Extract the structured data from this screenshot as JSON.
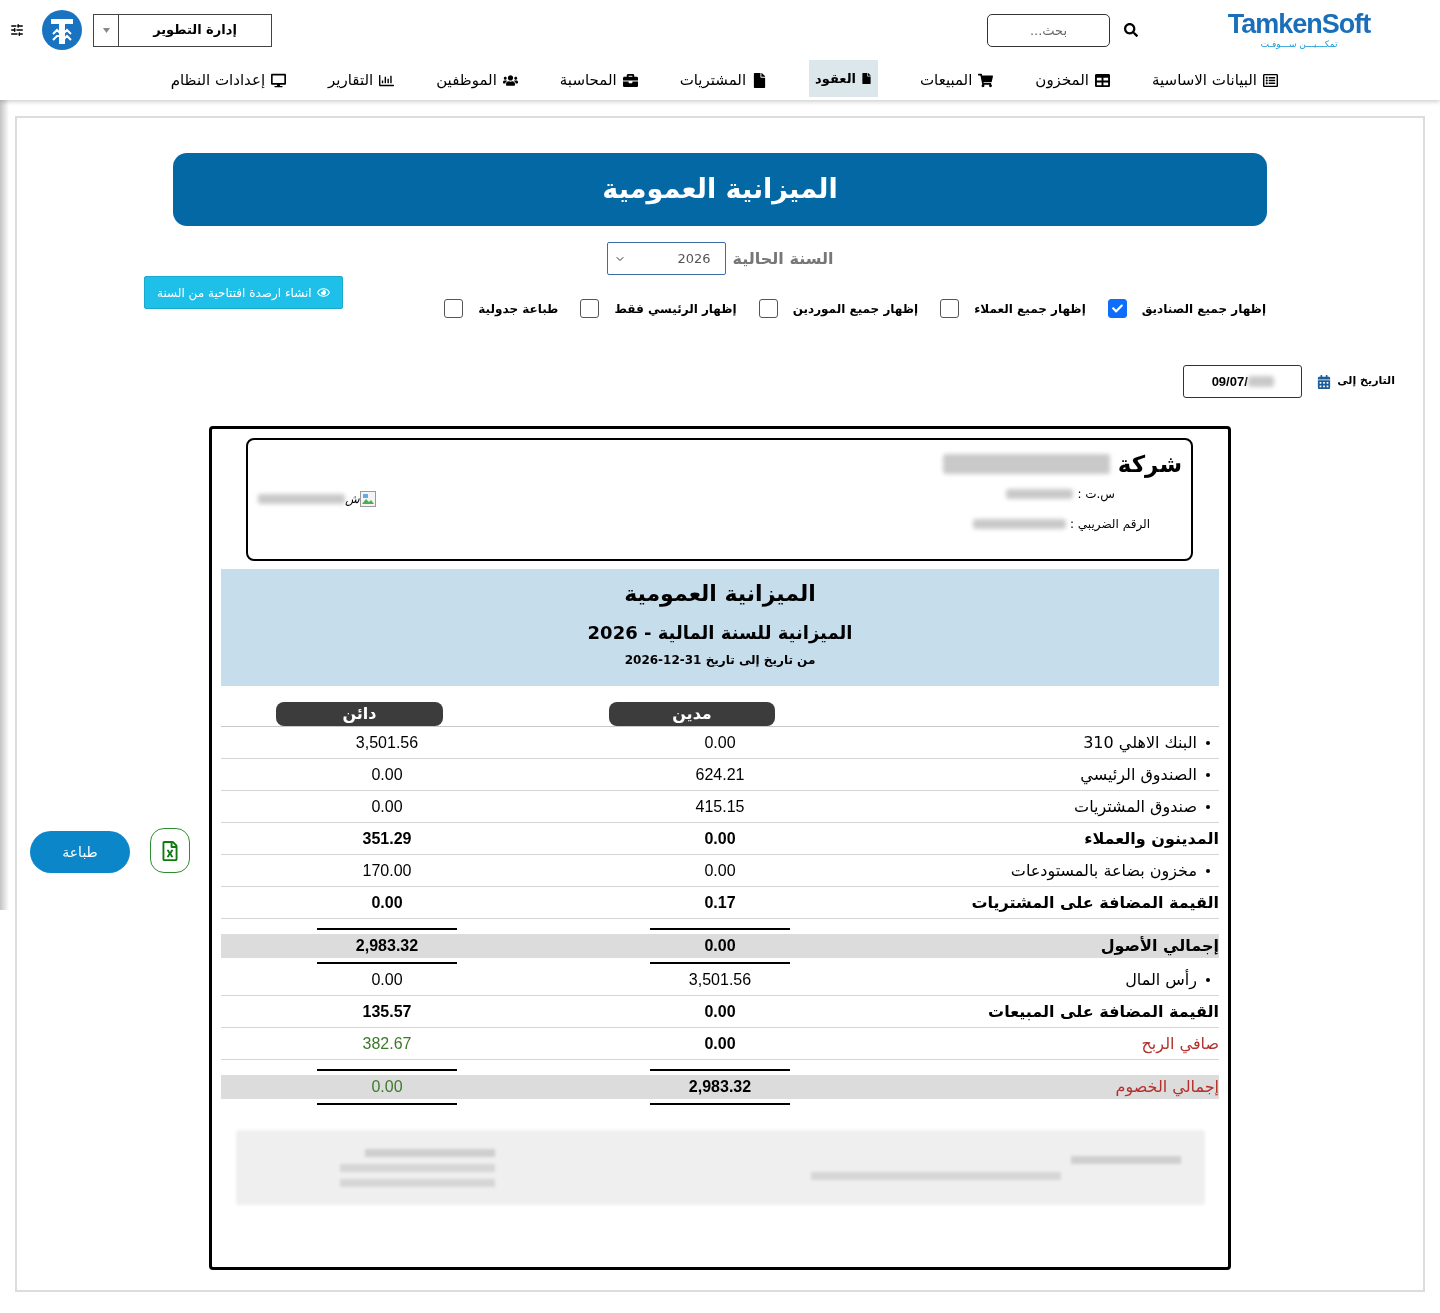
{
  "header": {
    "logo_text": "TamkenSoft",
    "logo_tagline": "تمكـــيـــن ســـوفـت",
    "search": {
      "placeholder": "بحث..."
    },
    "branch_select": {
      "value": "إدارة التطوير"
    }
  },
  "nav": [
    {
      "label": "البيانات الاساسية",
      "selected": false
    },
    {
      "label": "المخزون",
      "selected": false
    },
    {
      "label": "المبيعات",
      "selected": false
    },
    {
      "label": "العقود",
      "selected": true
    },
    {
      "label": "المشتريات",
      "selected": false
    },
    {
      "label": "المحاسبة",
      "selected": false
    },
    {
      "label": "الموظفين",
      "selected": false
    },
    {
      "label": "التقارير",
      "selected": false
    },
    {
      "label": "إعدادات النظام",
      "selected": false
    }
  ],
  "page_title": "الميزانية العمومية",
  "year_filter": {
    "label": "السنة الحالية",
    "value": "2026"
  },
  "opening_balance_button": "انشاء ارصدة افتتاحية من السنة",
  "options": [
    {
      "label": "إظهار جميع الصناديق",
      "checked": true
    },
    {
      "label": "إظهار جميع العملاء",
      "checked": false
    },
    {
      "label": "إظهار جميع الموردين",
      "checked": false
    },
    {
      "label": "إظهار الرئيسي فقط",
      "checked": false
    },
    {
      "label": "طباعة جدولية",
      "checked": false
    }
  ],
  "date_filter": {
    "label": "التاريخ إلى",
    "value": "09/07/"
  },
  "report": {
    "company": {
      "prefix": "شركة",
      "cr_label": "س.ت :",
      "tax_label": "الرقم الضريبي :",
      "logo_alt": "ش"
    },
    "title": "الميزانية العمومية",
    "subtitle": "الميزانية للسنة المالية - 2026",
    "period": "من تاريخ إلى تاريخ 31-12-2026",
    "columns": [
      "مدين",
      "دائن"
    ],
    "rows": [
      {
        "kind": "account",
        "label": "البنك الاهلي 310",
        "debit": "0.00",
        "credit": "3,501.56",
        "accent": false
      },
      {
        "kind": "account",
        "label": "الصندوق الرئيسي",
        "debit": "624.21",
        "credit": "0.00",
        "accent": false
      },
      {
        "kind": "account",
        "label": "صندوق المشتريات",
        "debit": "415.15",
        "credit": "0.00",
        "accent": false
      },
      {
        "kind": "group",
        "label": "المدينون والعملاء",
        "debit": "0.00",
        "credit": "351.29",
        "accent": false
      },
      {
        "kind": "account",
        "label": "مخزون بضاعة بالمستودعات",
        "debit": "0.00",
        "credit": "170.00",
        "accent": false
      },
      {
        "kind": "group",
        "label": "القيمة المضافة على المشتريات",
        "debit": "0.17",
        "credit": "0.00",
        "accent": false
      },
      {
        "kind": "total",
        "label": "إجمالي الأصول",
        "debit": "0.00",
        "credit": "2,983.32",
        "accent": false
      },
      {
        "kind": "account",
        "label": "رأس المال",
        "debit": "3,501.56",
        "credit": "0.00",
        "accent": false
      },
      {
        "kind": "group",
        "label": "القيمة المضافة على المبيعات",
        "debit": "0.00",
        "credit": "135.57",
        "accent": false
      },
      {
        "kind": "group",
        "label": "صافي الربح",
        "debit": "0.00",
        "credit": "382.67",
        "accent": true
      },
      {
        "kind": "total",
        "label": "إجمالي الخصوم",
        "debit": "2,983.32",
        "credit": "0.00",
        "accent": true
      }
    ]
  },
  "print_button": "طباعة"
}
